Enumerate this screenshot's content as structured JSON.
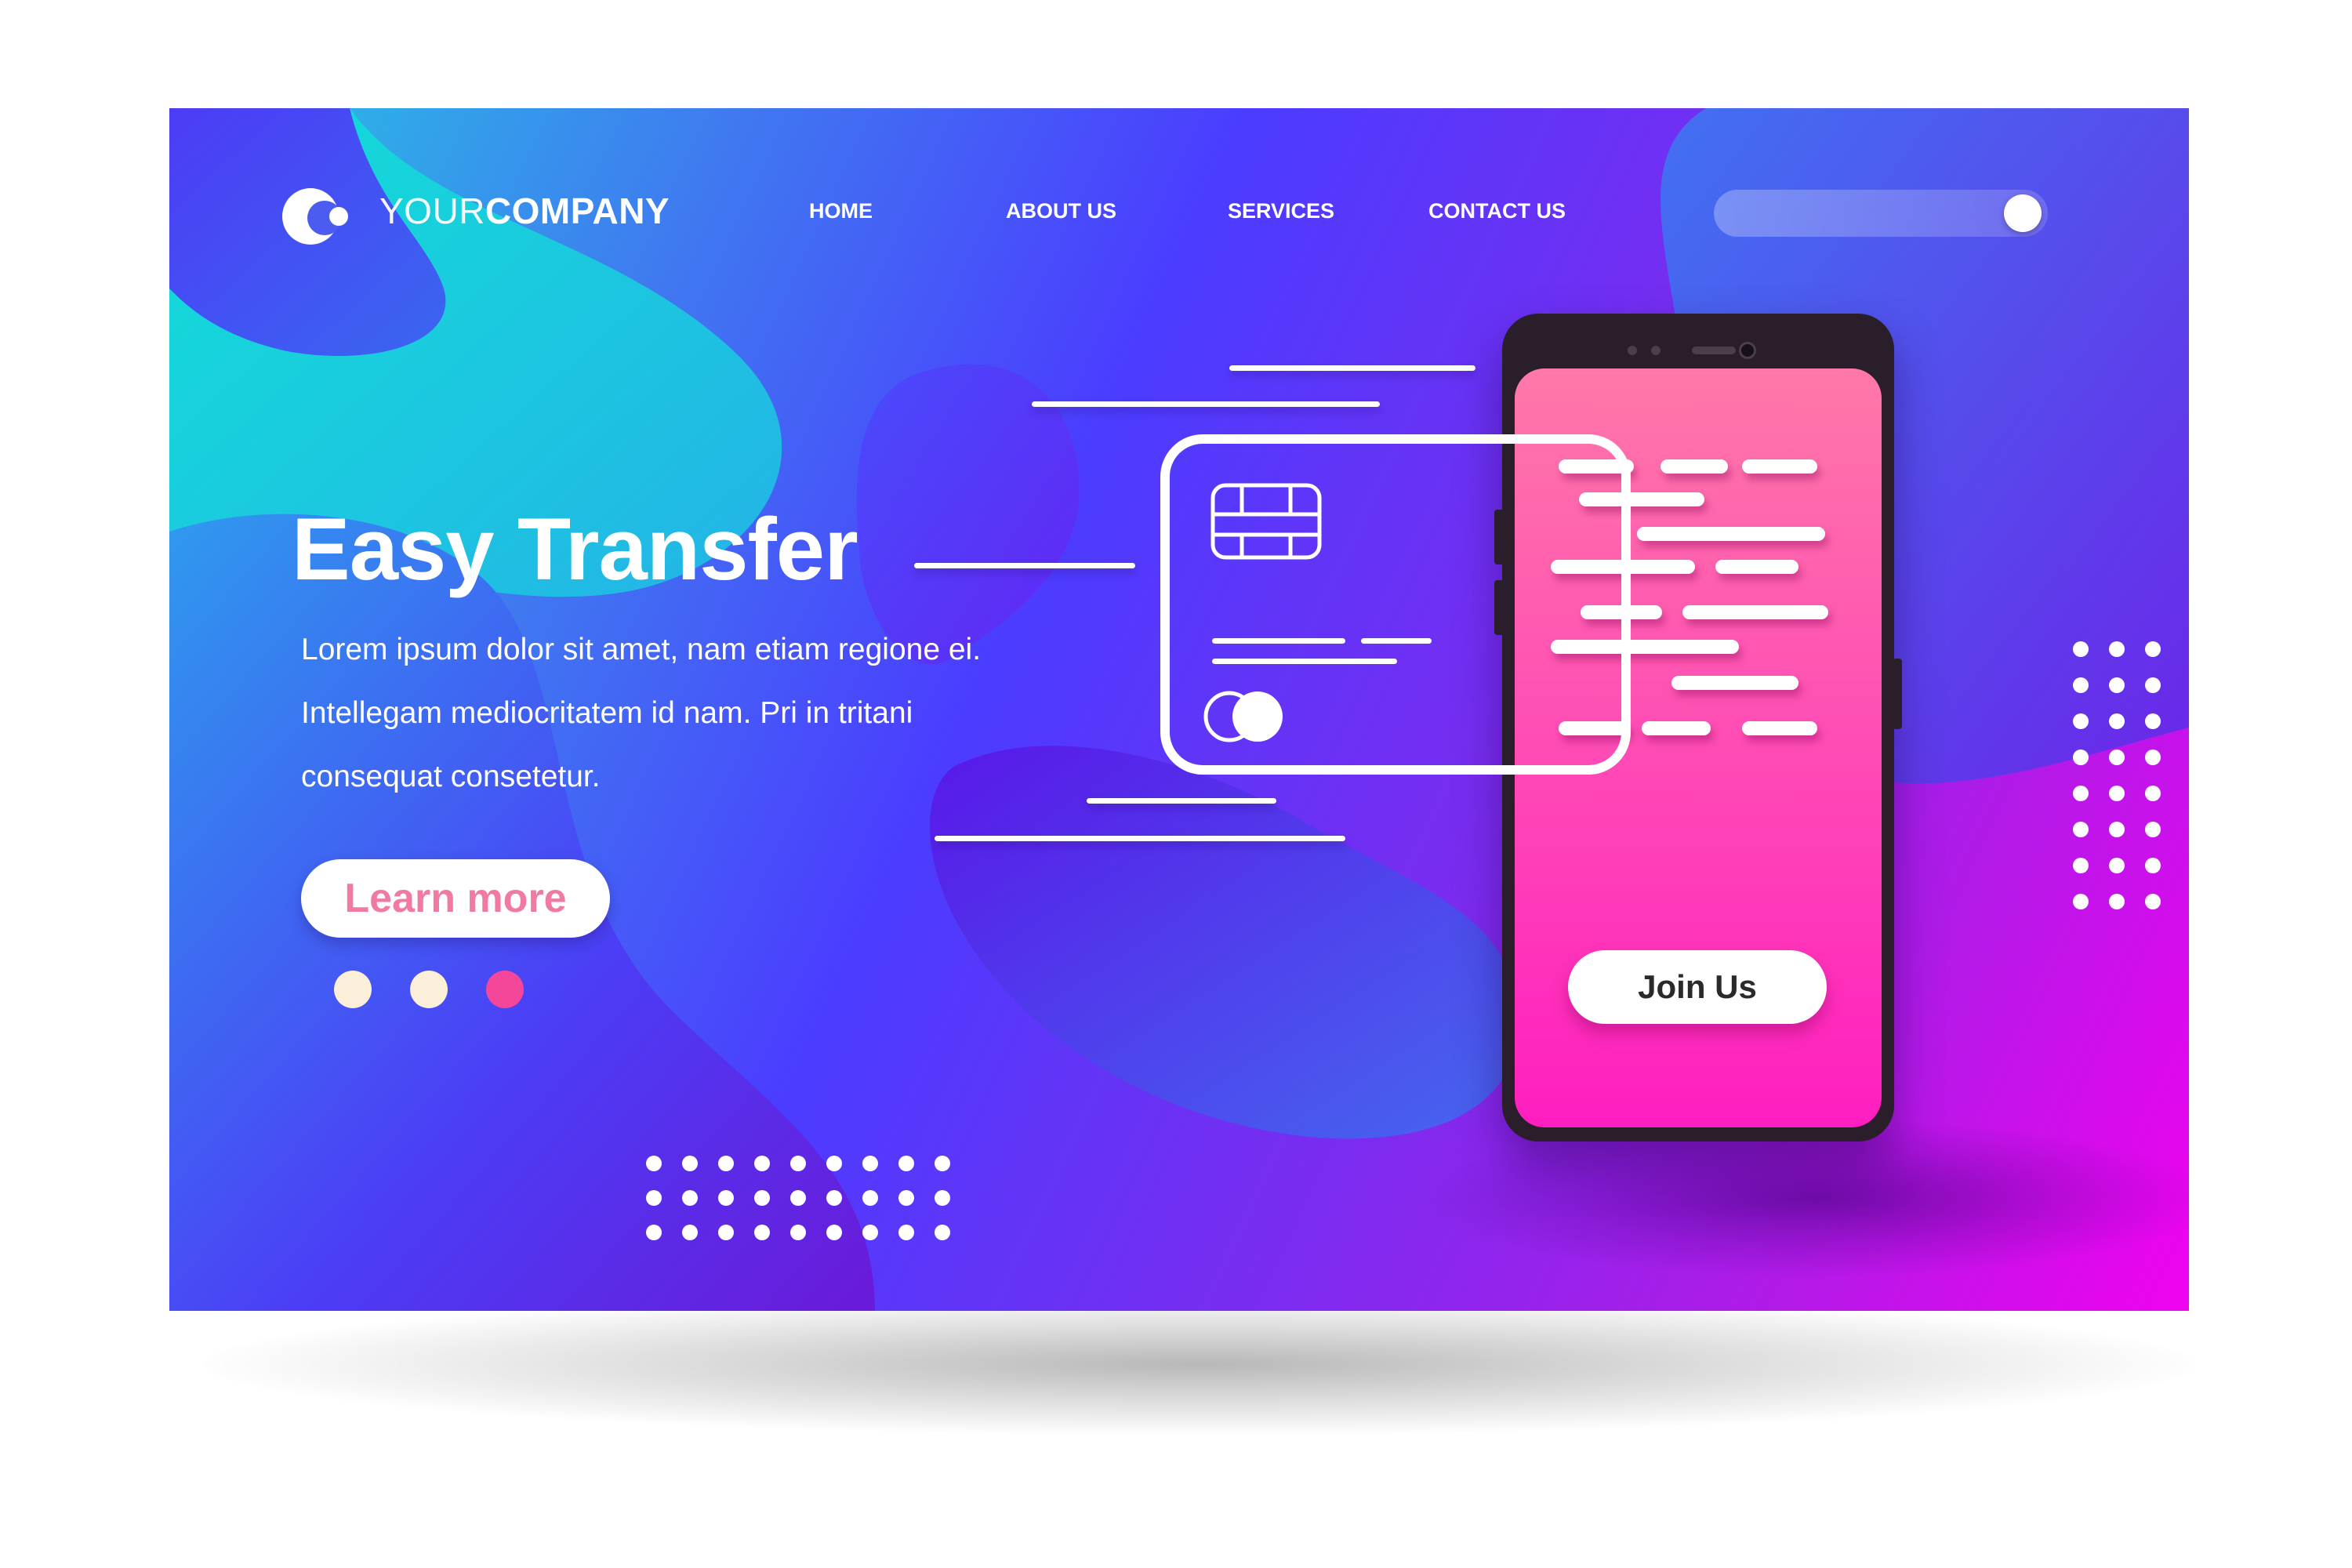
{
  "brand": {
    "prefix": "YOUR",
    "name": "COMPANY"
  },
  "nav": {
    "items": [
      {
        "label": "HOME"
      },
      {
        "label": "ABOUT US"
      },
      {
        "label": "SERVICES"
      },
      {
        "label": "CONTACT US"
      }
    ]
  },
  "hero": {
    "title": "Easy Transfer",
    "body": "Lorem ipsum dolor sit amet, nam etiam regione ei. Intellegam mediocritatem id nam. Pri in tritani consequat consetetur.",
    "cta_label": "Learn more",
    "slides": {
      "count": 3,
      "active_index": 2
    }
  },
  "phone": {
    "cta_label": "Join Us"
  },
  "colors": {
    "accent_pink": "#f5479a",
    "dot_inactive": "#fbefd9",
    "cta_text": "#f07aa0"
  },
  "icons": [
    "logo-icon",
    "search-knob-icon",
    "card-chip-icon",
    "card-brand-icon"
  ]
}
